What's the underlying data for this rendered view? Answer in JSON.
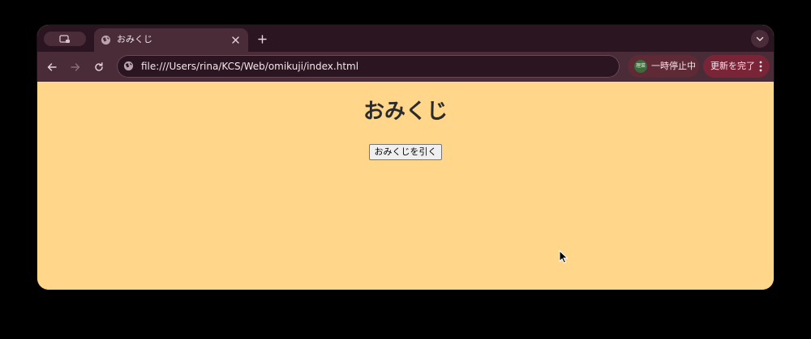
{
  "browser": {
    "tab": {
      "title": "おみくじ"
    },
    "address_bar": {
      "url": "file:///Users/rina/KCS/Web/omikuji/index.html"
    },
    "profile": {
      "avatar_text": "理菜",
      "paused_label": "一時停止中"
    },
    "update": {
      "label": "更新を完了"
    }
  },
  "page": {
    "heading": "おみくじ",
    "draw_button_label": "おみくじを引く"
  },
  "colors": {
    "page_background": "#ffd68a",
    "tabstrip": "#2b1520",
    "toolbar": "#4a2c38",
    "update_chip": "#7a2438"
  },
  "icons": {
    "tab_search": "tab-search-icon",
    "favicon": "globe-icon",
    "tab_close": "close-icon",
    "new_tab": "plus-icon",
    "tab_menu": "chevron-down-icon",
    "back": "back-arrow-icon",
    "forward": "forward-arrow-icon",
    "reload": "reload-icon",
    "site_info": "globe-icon",
    "more": "kebab-menu-icon",
    "cursor": "mouse-pointer-icon"
  }
}
